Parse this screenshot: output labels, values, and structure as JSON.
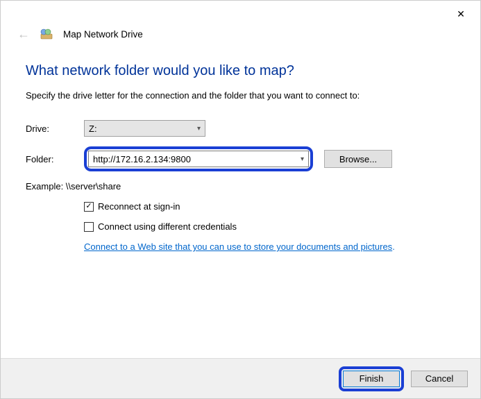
{
  "titlebar": {
    "close_glyph": "✕"
  },
  "header": {
    "back_glyph": "←",
    "title": "Map Network Drive"
  },
  "main": {
    "heading": "What network folder would you like to map?",
    "instruction": "Specify the drive letter for the connection and the folder that you want to connect to:",
    "drive_label": "Drive:",
    "drive_value": "Z:",
    "folder_label": "Folder:",
    "folder_value": "http://172.16.2.134:9800",
    "browse_label": "Browse...",
    "example_label": "Example: \\\\server\\share",
    "reconnect_label": "Reconnect at sign-in",
    "reconnect_checked": true,
    "credentials_label": "Connect using different credentials",
    "credentials_checked": false,
    "website_link": "Connect to a Web site that you can use to store your documents and pictures",
    "website_link_suffix": "."
  },
  "footer": {
    "finish_label": "Finish",
    "cancel_label": "Cancel"
  }
}
